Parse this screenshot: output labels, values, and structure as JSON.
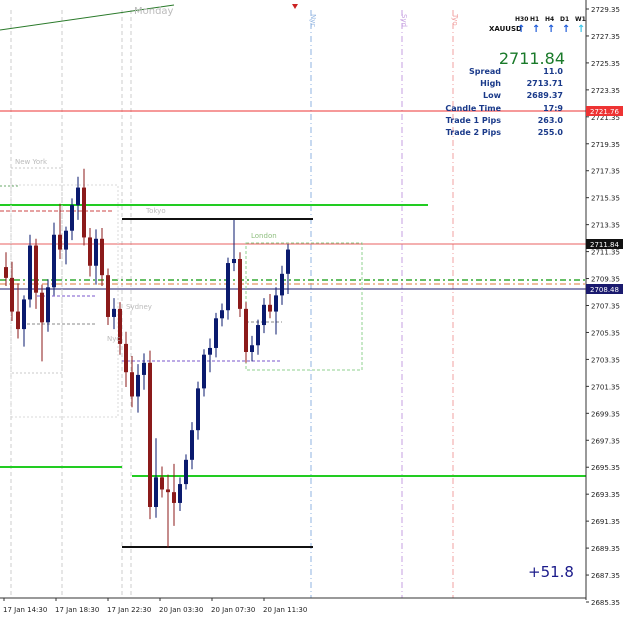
{
  "symbol": "XAUUSD",
  "timeframes": [
    "H30",
    "H1",
    "H4",
    "D1",
    "W1"
  ],
  "price_display": "2711.84",
  "stats": [
    {
      "label": "Spread",
      "value": "11.0"
    },
    {
      "label": "High",
      "value": "2713.71"
    },
    {
      "label": "Low",
      "value": "2689.37"
    },
    {
      "label": "Candle Time",
      "value": "17:9"
    },
    {
      "label": "Trade 1 Pips",
      "value": "263.0"
    },
    {
      "label": "Trade 2 Pips",
      "value": "255.0"
    }
  ],
  "profit": "+51.8",
  "session_labels": {
    "new_york": "New York",
    "tokyo": "Tokyo",
    "sydney": "Sydney",
    "london": "London",
    "monday": "Monday",
    "nyc": "Nyc",
    "syd": "Syd",
    "tyo": "Tyo",
    "nyc_short": "Nyc"
  },
  "price_tags": {
    "red": "2721.76",
    "current": "2711.84",
    "navy": "2708.48"
  },
  "colors": {
    "bull": "#0a1a6e",
    "bear": "#8b1a1a",
    "green": "#22cc22",
    "red": "#ee3333",
    "navy": "#1a1a6e",
    "gray": "#555555",
    "up_arrow": "#1e5bd8",
    "last_arrow": "#3fc6e8",
    "price_green": "#1a7a2a"
  },
  "chart_data": {
    "type": "candlestick",
    "y_ticks": [
      "2729.35",
      "2727.35",
      "2725.35",
      "2723.35",
      "2721.35",
      "2719.35",
      "2717.35",
      "2715.35",
      "2713.35",
      "2711.35",
      "2709.35",
      "2707.35",
      "2705.35",
      "2703.35",
      "2701.35",
      "2699.35",
      "2697.35",
      "2695.35",
      "2693.35",
      "2691.35",
      "2689.35",
      "2687.35",
      "2685.35"
    ],
    "y_range": [
      2685.35,
      2729.35
    ],
    "x_labels": [
      "17 Jan 14:30",
      "17 Jan 18:30",
      "17 Jan 22:30",
      "20 Jan 03:30",
      "20 Jan 07:30",
      "20 Jan 11:30"
    ],
    "candles": [
      [
        2710.2,
        2711.3,
        2708.8,
        2709.4
      ],
      [
        2709.4,
        2710.6,
        2706.2,
        2706.9
      ],
      [
        2706.9,
        2709.0,
        2704.9,
        2705.6
      ],
      [
        2705.6,
        2708.1,
        2704.3,
        2707.8
      ],
      [
        2707.8,
        2712.6,
        2707.2,
        2711.8
      ],
      [
        2711.8,
        2712.3,
        2707.1,
        2708.3
      ],
      [
        2708.3,
        2708.9,
        2703.2,
        2706.1
      ],
      [
        2706.1,
        2709.3,
        2705.4,
        2708.7
      ],
      [
        2708.7,
        2713.5,
        2708.1,
        2712.6
      ],
      [
        2712.6,
        2714.9,
        2710.8,
        2711.5
      ],
      [
        2711.5,
        2713.2,
        2710.4,
        2712.9
      ],
      [
        2712.9,
        2715.3,
        2712.2,
        2714.8
      ],
      [
        2714.8,
        2716.9,
        2713.7,
        2716.1
      ],
      [
        2716.1,
        2717.5,
        2711.8,
        2712.4
      ],
      [
        2712.4,
        2713.1,
        2709.5,
        2710.3
      ],
      [
        2710.3,
        2713.0,
        2708.9,
        2712.3
      ],
      [
        2712.3,
        2713.1,
        2708.8,
        2709.6
      ],
      [
        2709.6,
        2710.1,
        2705.9,
        2706.5
      ],
      [
        2706.5,
        2707.9,
        2705.6,
        2707.1
      ],
      [
        2707.1,
        2707.6,
        2703.7,
        2704.5
      ],
      [
        2704.5,
        2705.4,
        2701.3,
        2702.4
      ],
      [
        2702.4,
        2703.6,
        2699.8,
        2700.6
      ],
      [
        2700.6,
        2703.0,
        2699.4,
        2702.2
      ],
      [
        2702.2,
        2703.8,
        2701.1,
        2703.1
      ],
      [
        2703.1,
        2704.0,
        2691.5,
        2692.4
      ],
      [
        2692.4,
        2697.5,
        2691.6,
        2694.6
      ],
      [
        2694.6,
        2695.4,
        2693.1,
        2693.7
      ],
      [
        2693.7,
        2694.8,
        2689.4,
        2693.5
      ],
      [
        2693.5,
        2695.6,
        2691.0,
        2692.7
      ],
      [
        2692.7,
        2694.6,
        2692.1,
        2694.1
      ],
      [
        2694.1,
        2696.3,
        2693.7,
        2695.9
      ],
      [
        2695.9,
        2698.7,
        2695.2,
        2698.1
      ],
      [
        2698.1,
        2701.7,
        2697.4,
        2701.2
      ],
      [
        2701.2,
        2704.1,
        2700.6,
        2703.7
      ],
      [
        2703.7,
        2704.9,
        2702.4,
        2704.2
      ],
      [
        2704.2,
        2706.8,
        2703.5,
        2706.4
      ],
      [
        2706.4,
        2707.5,
        2705.8,
        2707.0
      ],
      [
        2707.0,
        2710.9,
        2706.3,
        2710.5
      ],
      [
        2710.5,
        2713.7,
        2709.9,
        2710.8
      ],
      [
        2710.8,
        2711.3,
        2706.5,
        2707.1
      ],
      [
        2707.1,
        2707.6,
        2703.1,
        2703.9
      ],
      [
        2703.9,
        2705.1,
        2703.2,
        2704.4
      ],
      [
        2704.4,
        2706.3,
        2703.7,
        2705.9
      ],
      [
        2705.9,
        2707.9,
        2705.3,
        2707.4
      ],
      [
        2707.4,
        2708.2,
        2706.4,
        2706.9
      ],
      [
        2706.9,
        2708.7,
        2705.2,
        2708.1
      ],
      [
        2708.1,
        2710.3,
        2707.4,
        2709.7
      ],
      [
        2709.7,
        2711.9,
        2708.2,
        2711.5
      ]
    ]
  }
}
